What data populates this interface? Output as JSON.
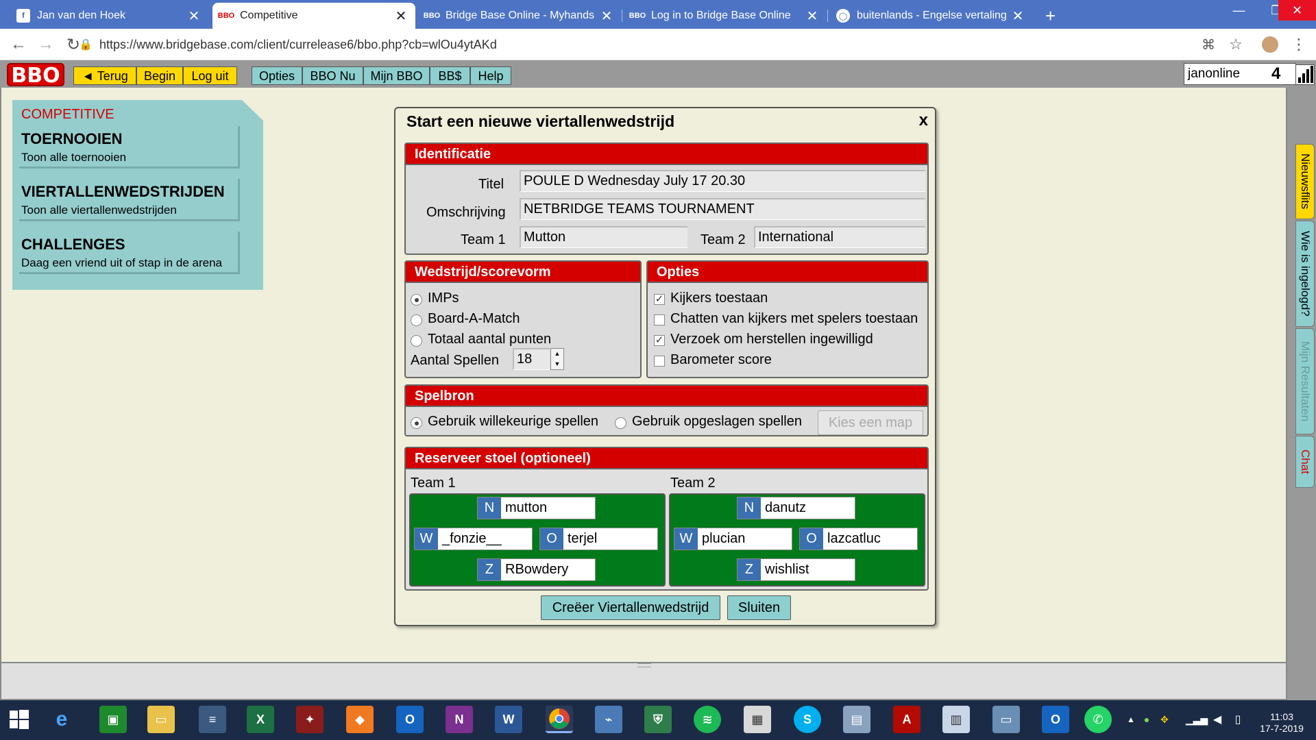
{
  "browser": {
    "tabs": [
      {
        "title": "Jan van den Hoek",
        "icon": "facebook-icon"
      },
      {
        "title": "Competitive",
        "icon": "bbo-icon",
        "active": true
      },
      {
        "title": "Bridge Base Online - Myhands",
        "icon": "bbo-icon"
      },
      {
        "title": "Log in to Bridge Base Online",
        "icon": "bbo-icon"
      },
      {
        "title": "buitenlands - Engelse vertaling -",
        "icon": "translate-icon"
      }
    ],
    "url": "https://www.bridgebase.com/client/currelease6/bbo.php?cb=wlOu4ytAKd"
  },
  "bbo": {
    "logo": "BBO",
    "menu": {
      "back": "◄ Terug",
      "begin": "Begin",
      "logout": "Log uit",
      "options": "Opties",
      "bbo_now": "BBO Nu",
      "my_bbo": "Mijn BBO",
      "bbs": "BB$",
      "help": "Help"
    },
    "username": "janonline",
    "user_count": "4"
  },
  "side_tabs": [
    "Nieuwsflits",
    "Wie is ingelogd?",
    "Mijn Resultaten",
    "Chat"
  ],
  "competitive": {
    "title": "COMPETITIVE",
    "items": [
      {
        "heading": "TOERNOOIEN",
        "sub": "Toon alle toernooien"
      },
      {
        "heading": "VIERTALLENWEDSTRIJDEN",
        "sub": "Toon alle viertallenwedstrijden"
      },
      {
        "heading": "CHALLENGES",
        "sub": "Daag een vriend uit of stap in de arena"
      }
    ]
  },
  "dialog": {
    "title": "Start een nieuwe viertallenwedstrijd",
    "close": "x",
    "identification": {
      "header": "Identificatie",
      "title_label": "Titel",
      "title_value": "POULE D Wednesday July 17 20.30",
      "desc_label": "Omschrijving",
      "desc_value": "NETBRIDGE TEAMS TOURNAMENT",
      "team1_label": "Team 1",
      "team1_value": "Mutton",
      "team2_label": "Team 2",
      "team2_value": "International"
    },
    "scoring": {
      "header": "Wedstrijd/scorevorm",
      "options": [
        "IMPs",
        "Board-A-Match",
        "Totaal aantal punten"
      ],
      "selected": 0,
      "boards_label": "Aantal Spellen",
      "boards_value": "18"
    },
    "options": {
      "header": "Opties",
      "items": [
        {
          "label": "Kijkers toestaan",
          "checked": true
        },
        {
          "label": "Chatten van kijkers met spelers toestaan",
          "checked": false
        },
        {
          "label": "Verzoek om herstellen ingewilligd",
          "checked": true
        },
        {
          "label": "Barometer score",
          "checked": false
        }
      ]
    },
    "source": {
      "header": "Spelbron",
      "random": "Gebruik willekeurige spellen",
      "saved": "Gebruik opgeslagen spellen",
      "pick_folder": "Kies een map"
    },
    "seats": {
      "header": "Reserveer stoel (optioneel)",
      "team1_label": "Team 1",
      "team2_label": "Team 2",
      "team1": {
        "N": "mutton",
        "W": "_fonzie__",
        "O": "terjel",
        "Z": "RBowdery"
      },
      "team2": {
        "N": "danutz",
        "W": "plucian",
        "O": "lazcatluc",
        "Z": "wishlist"
      },
      "dir_labels": {
        "N": "N",
        "W": "W",
        "O": "O",
        "Z": "Z"
      }
    },
    "create_button": "Creëer Viertallenwedstrijd",
    "close_button": "Sluiten"
  },
  "taskbar": {
    "time": "11:03",
    "date": "17-7-2019"
  }
}
